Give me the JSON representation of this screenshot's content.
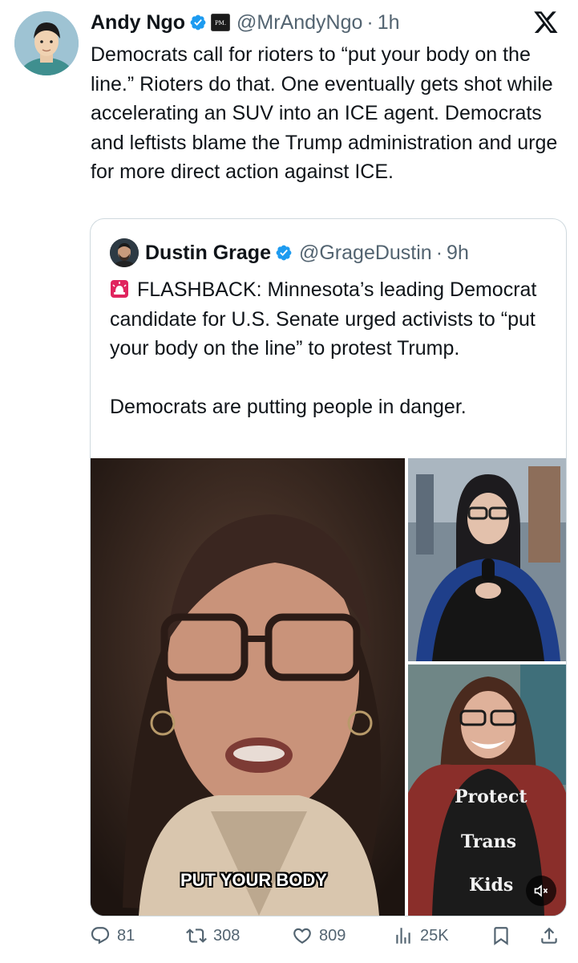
{
  "tweet": {
    "author_name": "Andy Ngo",
    "affiliation_badge_text": "PM.",
    "handle": "@MrAndyNgo",
    "separator": "·",
    "time": "1h",
    "text": "Democrats call for rioters to “put your body on the line.” Rioters do that. One eventually gets shot while accelerating an SUV into an ICE agent. Democrats and leftists blame the Trump administration and urge for more direct action against ICE."
  },
  "quote": {
    "author_name": "Dustin Grage",
    "handle": "@GrageDustin",
    "separator": "·",
    "time": "9h",
    "text_line1": "FLASHBACK: Minnesota’s leading Democrat candidate for U.S. Senate urged activists to “put your body on the line” to protest Trump.",
    "text_line2": "Democrats are putting people in danger.",
    "media": {
      "video_caption": "PUT YOUR BODY",
      "shirt_words": [
        "Protect",
        "Trans",
        "Kids"
      ]
    }
  },
  "actions": {
    "replies": "81",
    "reposts": "308",
    "likes": "809",
    "views": "25K"
  },
  "icons": {
    "brand": "x-logo",
    "verified": "verified-badge-icon",
    "siren": "rotating-light-icon",
    "reply": "reply-icon",
    "repost": "repost-icon",
    "like": "heart-icon",
    "views": "views-icon",
    "bookmark": "bookmark-icon",
    "share": "share-icon",
    "mute": "muted-speaker-icon"
  },
  "colors": {
    "verified_blue": "#1d9bf0",
    "text": "#0f1419",
    "secondary": "#536471",
    "border": "#cfd9de"
  }
}
